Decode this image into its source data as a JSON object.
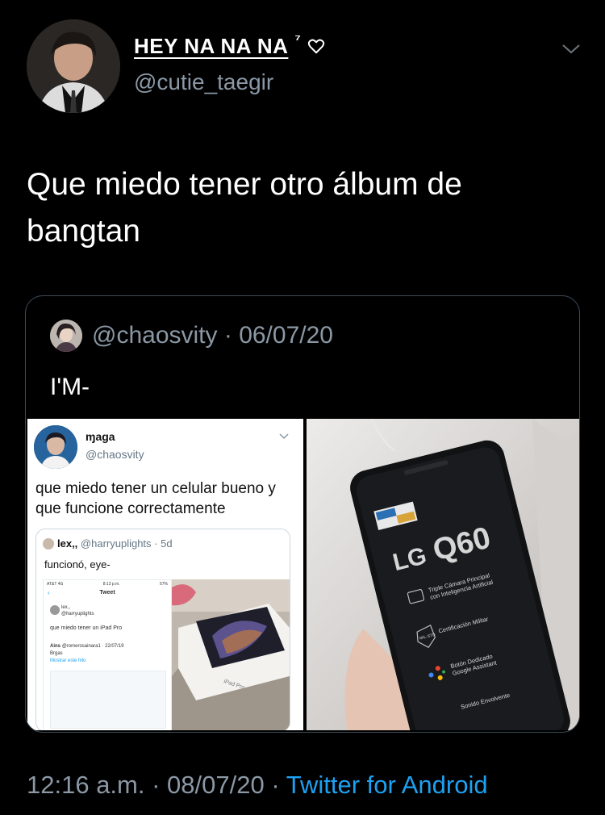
{
  "tweet": {
    "display_name": "HEY NA NA NA",
    "display_name_suffix": "⁷",
    "handle": "@cutie_taegir",
    "text": "Que miedo tener otro álbum de bangtan",
    "time": "12:16 a.m.",
    "date": "08/07/20",
    "source": "Twitter for Android"
  },
  "quote": {
    "handle": "@chaosvity",
    "date": "06/07/20",
    "text": "I'M-"
  },
  "media_left": {
    "name": "ɱaga",
    "handle": "@chaosvity",
    "text": "que miedo tener un celular bueno y que funcione correctamente",
    "inner_quote": {
      "name": "lex,,",
      "handle": "@harryuplights",
      "age": "5d",
      "text": "funcionó, eye-",
      "screenshot": {
        "carrier": "AT&T 4G",
        "time": "8:13 p.m.",
        "battery": "57%",
        "title": "Tweet",
        "user_name": "lex,,",
        "user_handle": "@harryuplights",
        "text": "que miedo tener un iPad Pro",
        "reply_name": "Ains",
        "reply_handle": "@romerosainara1 · 22/07/19",
        "reply_text": "Brgas",
        "reply_link": "Mostrar este hilo"
      },
      "box_label": "iPad Pro"
    }
  },
  "media_right": {
    "brand": "LG",
    "model": "Q60",
    "feature_1_title": "Triple Cámara Principal",
    "feature_1_sub": "con Inteligencia Artificial",
    "feature_2_icon_label": "MIL-STD",
    "feature_2_title": "Certificación Militar",
    "feature_3_title": "Botón Dedicado",
    "feature_3_sub": "Google Assistant",
    "feature_4_title": "Sonido Envolvente"
  },
  "colors": {
    "background": "#000000",
    "secondary_text": "#8b98a5",
    "link": "#1da1f2",
    "card_border": "#3d4a57"
  }
}
